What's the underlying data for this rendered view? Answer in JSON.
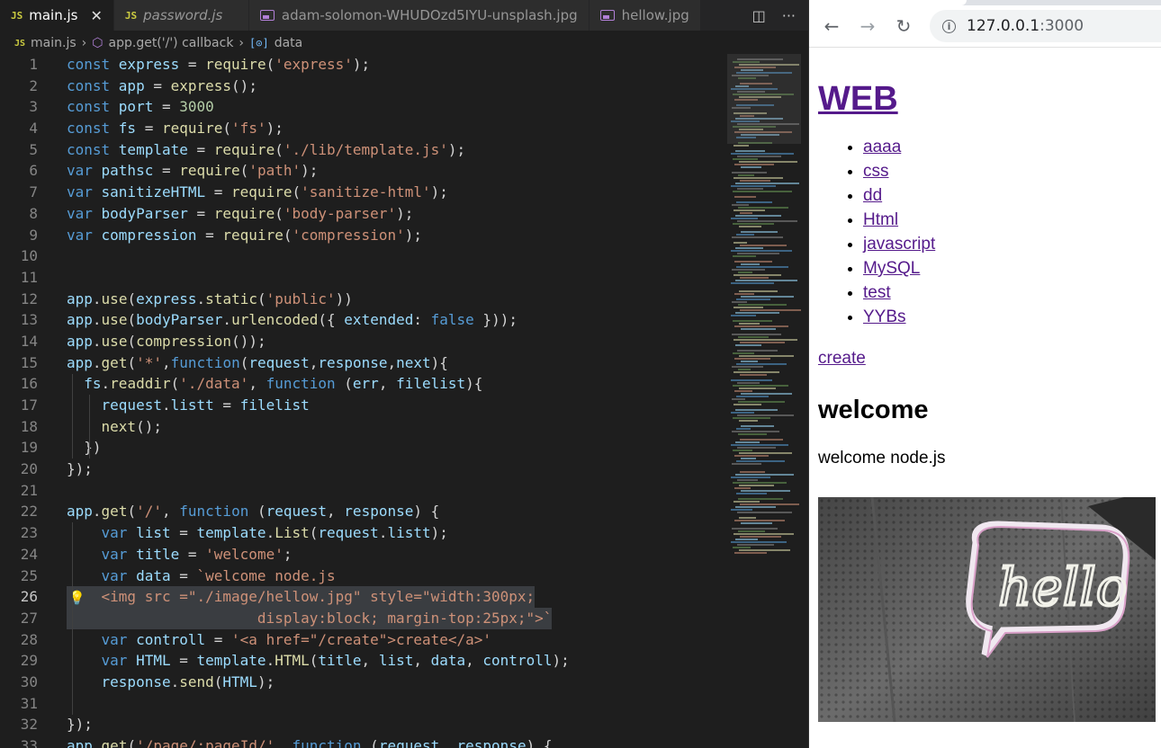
{
  "editor": {
    "tabs": [
      {
        "label": "main.js",
        "type": "js",
        "active": true
      },
      {
        "label": "password.js",
        "type": "js",
        "active": false
      },
      {
        "label": "adam-solomon-WHUDOzd5IYU-unsplash.jpg",
        "type": "image",
        "active": false
      },
      {
        "label": "hellow.jpg",
        "type": "image",
        "active": false
      }
    ],
    "breadcrumb": {
      "file": "main.js",
      "callback": "app.get('/') callback",
      "symbol": "data"
    },
    "code": [
      [
        [
          "kw",
          "const "
        ],
        [
          "vr",
          "express"
        ],
        [
          "pn",
          " = "
        ],
        [
          "fn",
          "require"
        ],
        [
          "pn",
          "("
        ],
        [
          "st",
          "'express'"
        ],
        [
          "pn",
          ");"
        ]
      ],
      [
        [
          "kw",
          "const "
        ],
        [
          "vr",
          "app"
        ],
        [
          "pn",
          " = "
        ],
        [
          "fn",
          "express"
        ],
        [
          "pn",
          "();"
        ]
      ],
      [
        [
          "kw",
          "const "
        ],
        [
          "vr",
          "port"
        ],
        [
          "pn",
          " = "
        ],
        [
          "nu",
          "3000"
        ]
      ],
      [
        [
          "kw",
          "const "
        ],
        [
          "vr",
          "fs"
        ],
        [
          "pn",
          " = "
        ],
        [
          "fn",
          "require"
        ],
        [
          "pn",
          "("
        ],
        [
          "st",
          "'fs'"
        ],
        [
          "pn",
          ");"
        ]
      ],
      [
        [
          "kw",
          "const "
        ],
        [
          "vr",
          "template"
        ],
        [
          "pn",
          " = "
        ],
        [
          "fn",
          "require"
        ],
        [
          "pn",
          "("
        ],
        [
          "st",
          "'./lib/template.js'"
        ],
        [
          "pn",
          ");"
        ]
      ],
      [
        [
          "kw",
          "var "
        ],
        [
          "vr",
          "pathsc"
        ],
        [
          "pn",
          " = "
        ],
        [
          "fn",
          "require"
        ],
        [
          "pn",
          "("
        ],
        [
          "st",
          "'path'"
        ],
        [
          "pn",
          ");"
        ]
      ],
      [
        [
          "kw",
          "var "
        ],
        [
          "vr",
          "sanitizeHTML"
        ],
        [
          "pn",
          " = "
        ],
        [
          "fn",
          "require"
        ],
        [
          "pn",
          "("
        ],
        [
          "st",
          "'sanitize-html'"
        ],
        [
          "pn",
          ");"
        ]
      ],
      [
        [
          "kw",
          "var "
        ],
        [
          "vr",
          "bodyParser"
        ],
        [
          "pn",
          " = "
        ],
        [
          "fn",
          "require"
        ],
        [
          "pn",
          "("
        ],
        [
          "st",
          "'body-parser'"
        ],
        [
          "pn",
          ");"
        ]
      ],
      [
        [
          "kw",
          "var "
        ],
        [
          "vr",
          "compression"
        ],
        [
          "pn",
          " = "
        ],
        [
          "fn",
          "require"
        ],
        [
          "pn",
          "("
        ],
        [
          "st",
          "'compression'"
        ],
        [
          "pn",
          ");"
        ]
      ],
      [],
      [],
      [
        [
          "vr",
          "app"
        ],
        [
          "pn",
          "."
        ],
        [
          "fn",
          "use"
        ],
        [
          "pn",
          "("
        ],
        [
          "vr",
          "express"
        ],
        [
          "pn",
          "."
        ],
        [
          "fn",
          "static"
        ],
        [
          "pn",
          "("
        ],
        [
          "st",
          "'public'"
        ],
        [
          "pn",
          "))"
        ]
      ],
      [
        [
          "vr",
          "app"
        ],
        [
          "pn",
          "."
        ],
        [
          "fn",
          "use"
        ],
        [
          "pn",
          "("
        ],
        [
          "vr",
          "bodyParser"
        ],
        [
          "pn",
          "."
        ],
        [
          "fn",
          "urlencoded"
        ],
        [
          "pn",
          "({ "
        ],
        [
          "vr",
          "extended"
        ],
        [
          "pn",
          ": "
        ],
        [
          "kw",
          "false"
        ],
        [
          "pn",
          " }));"
        ]
      ],
      [
        [
          "vr",
          "app"
        ],
        [
          "pn",
          "."
        ],
        [
          "fn",
          "use"
        ],
        [
          "pn",
          "("
        ],
        [
          "fn",
          "compression"
        ],
        [
          "pn",
          "());"
        ]
      ],
      [
        [
          "vr",
          "app"
        ],
        [
          "pn",
          "."
        ],
        [
          "fn",
          "get"
        ],
        [
          "pn",
          "("
        ],
        [
          "st",
          "'*'"
        ],
        [
          "pn",
          ","
        ],
        [
          "kw",
          "function"
        ],
        [
          "pn",
          "("
        ],
        [
          "vr",
          "request"
        ],
        [
          "pn",
          ","
        ],
        [
          "vr",
          "response"
        ],
        [
          "pn",
          ","
        ],
        [
          "vr",
          "next"
        ],
        [
          "pn",
          "){"
        ]
      ],
      [
        [
          "pn",
          "  "
        ],
        [
          "vr",
          "fs"
        ],
        [
          "pn",
          "."
        ],
        [
          "fn",
          "readdir"
        ],
        [
          "pn",
          "("
        ],
        [
          "st",
          "'./data'"
        ],
        [
          "pn",
          ", "
        ],
        [
          "kw",
          "function"
        ],
        [
          "pn",
          " ("
        ],
        [
          "vr",
          "err"
        ],
        [
          "pn",
          ", "
        ],
        [
          "vr",
          "filelist"
        ],
        [
          "pn",
          "){"
        ]
      ],
      [
        [
          "pn",
          "    "
        ],
        [
          "vr",
          "request"
        ],
        [
          "pn",
          "."
        ],
        [
          "vr",
          "listt"
        ],
        [
          "pn",
          " = "
        ],
        [
          "vr",
          "filelist"
        ]
      ],
      [
        [
          "pn",
          "    "
        ],
        [
          "fn",
          "next"
        ],
        [
          "pn",
          "();"
        ]
      ],
      [
        [
          "pn",
          "  })"
        ]
      ],
      [
        [
          "pn",
          "});"
        ]
      ],
      [],
      [
        [
          "vr",
          "app"
        ],
        [
          "pn",
          "."
        ],
        [
          "fn",
          "get"
        ],
        [
          "pn",
          "("
        ],
        [
          "st",
          "'/'"
        ],
        [
          "pn",
          ", "
        ],
        [
          "kw",
          "function"
        ],
        [
          "pn",
          " ("
        ],
        [
          "vr",
          "request"
        ],
        [
          "pn",
          ", "
        ],
        [
          "vr",
          "response"
        ],
        [
          "pn",
          ") {"
        ]
      ],
      [
        [
          "pn",
          "    "
        ],
        [
          "kw",
          "var "
        ],
        [
          "vr",
          "list"
        ],
        [
          "pn",
          " = "
        ],
        [
          "vr",
          "template"
        ],
        [
          "pn",
          "."
        ],
        [
          "fn",
          "List"
        ],
        [
          "pn",
          "("
        ],
        [
          "vr",
          "request"
        ],
        [
          "pn",
          "."
        ],
        [
          "vr",
          "listt"
        ],
        [
          "pn",
          ");"
        ]
      ],
      [
        [
          "pn",
          "    "
        ],
        [
          "kw",
          "var "
        ],
        [
          "vr",
          "title"
        ],
        [
          "pn",
          " = "
        ],
        [
          "st",
          "'welcome'"
        ],
        [
          "pn",
          ";"
        ]
      ],
      [
        [
          "pn",
          "    "
        ],
        [
          "kw",
          "var "
        ],
        [
          "vr",
          "data"
        ],
        [
          "pn",
          " = "
        ],
        [
          "st",
          "`welcome node.js"
        ]
      ],
      [
        [
          "st",
          "    <img src =\"./image/hellow.jpg\" style=\"width:300px;"
        ]
      ],
      [
        [
          "st",
          "                      display:block; margin-top:25px;\">`"
        ]
      ],
      [
        [
          "pn",
          "    "
        ],
        [
          "kw",
          "var "
        ],
        [
          "vr",
          "controll"
        ],
        [
          "pn",
          " = "
        ],
        [
          "st",
          "'<a href=\"/create\">create</a>'"
        ]
      ],
      [
        [
          "pn",
          "    "
        ],
        [
          "kw",
          "var "
        ],
        [
          "vr",
          "HTML"
        ],
        [
          "pn",
          " = "
        ],
        [
          "vr",
          "template"
        ],
        [
          "pn",
          "."
        ],
        [
          "fn",
          "HTML"
        ],
        [
          "pn",
          "("
        ],
        [
          "vr",
          "title"
        ],
        [
          "pn",
          ", "
        ],
        [
          "vr",
          "list"
        ],
        [
          "pn",
          ", "
        ],
        [
          "vr",
          "data"
        ],
        [
          "pn",
          ", "
        ],
        [
          "vr",
          "controll"
        ],
        [
          "pn",
          ");"
        ]
      ],
      [
        [
          "pn",
          "    "
        ],
        [
          "vr",
          "response"
        ],
        [
          "pn",
          "."
        ],
        [
          "fn",
          "send"
        ],
        [
          "pn",
          "("
        ],
        [
          "vr",
          "HTML"
        ],
        [
          "pn",
          ");"
        ]
      ],
      [],
      [
        [
          "pn",
          "});"
        ]
      ],
      [
        [
          "vr",
          "app"
        ],
        [
          "pn",
          "."
        ],
        [
          "fn",
          "get"
        ],
        [
          "pn",
          "("
        ],
        [
          "st",
          "'/page/:pageId/'"
        ],
        [
          "pn",
          ", "
        ],
        [
          "kw",
          "function"
        ],
        [
          "pn",
          " ("
        ],
        [
          "vr",
          "request"
        ],
        [
          "pn",
          ", "
        ],
        [
          "vr",
          "response"
        ],
        [
          "pn",
          ") {"
        ]
      ]
    ],
    "line_numbers": [
      "1",
      "2",
      "3",
      "4",
      "5",
      "6",
      "7",
      "8",
      "9",
      "10",
      "11",
      "12",
      "13",
      "14",
      "15",
      "16",
      "17",
      "18",
      "19",
      "20",
      "21",
      "22",
      "23",
      "24",
      "25",
      "26",
      "27",
      "28",
      "29",
      "30",
      "31",
      "32",
      "33"
    ],
    "highlighted_lines": [
      26,
      27
    ],
    "current_line": 26
  },
  "browser": {
    "url_host": "127.0.0.1",
    "url_port": ":3000",
    "page": {
      "heading": "WEB",
      "list_items": [
        "aaaa",
        "css",
        "dd",
        "Html",
        "javascript",
        "MySQL",
        "test",
        "YYBs"
      ],
      "create_link": "create",
      "title": "welcome",
      "description": "welcome node.js",
      "image_text": "hello"
    }
  },
  "colors": {
    "editor_bg": "#1e1e1e",
    "keyword": "#569cd6",
    "variable": "#9cdcfe",
    "function": "#dcdcaa",
    "string": "#ce9178",
    "number": "#b5cea8",
    "link_visited": "#551a8b"
  },
  "icons": [
    "js-file-icon",
    "image-file-icon",
    "close-icon",
    "split-editor-icon",
    "more-actions-icon",
    "cube-symbol-icon",
    "field-symbol-icon",
    "lightbulb-icon",
    "back-arrow-icon",
    "forward-arrow-icon",
    "reload-icon",
    "info-icon"
  ]
}
